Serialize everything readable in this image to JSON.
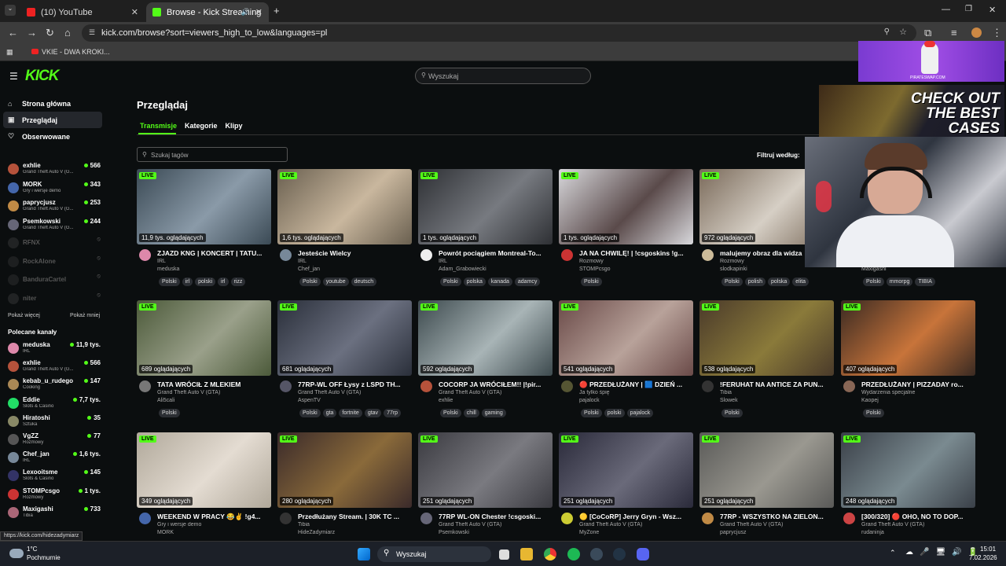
{
  "browser": {
    "tabs": [
      {
        "label": "(10) YouTube"
      },
      {
        "label": "Browse - Kick Streaming"
      }
    ],
    "url": "kick.com/browse?sort=viewers_high_to_low&languages=pl",
    "bookmark": "VKIE - DWA KROKI..."
  },
  "header": {
    "search_placeholder": "Wyszukaj"
  },
  "sidebar": {
    "nav": [
      {
        "label": "Strona główna"
      },
      {
        "label": "Przeglądaj"
      },
      {
        "label": "Obserwowane"
      }
    ],
    "followed": [
      {
        "name": "exhlie",
        "game": "Grand Theft Auto V (G...",
        "viewers": "566",
        "color": "#b5523b"
      },
      {
        "name": "MORK",
        "game": "Gry i wersje demo",
        "viewers": "343",
        "color": "#4466aa"
      },
      {
        "name": "paprycjusz",
        "game": "Grand Theft Auto V (G...",
        "viewers": "253",
        "color": "#c08a45"
      },
      {
        "name": "Psemkowski",
        "game": "Grand Theft Auto V (G...",
        "viewers": "244",
        "color": "#667"
      },
      {
        "name": "RFNX",
        "color": "#444"
      },
      {
        "name": "RockAlone",
        "color": "#3a3a3a"
      },
      {
        "name": "BanduraCartel",
        "color": "#3a3a3a"
      },
      {
        "name": "niter",
        "color": "#444"
      }
    ],
    "show_more": "Pokaż więcej",
    "show_less": "Pokaż mniej",
    "recommended_title": "Polecane kanały",
    "recommended": [
      {
        "name": "meduska",
        "game": "IRL",
        "viewers": "11,9 tys.",
        "color": "#d8a"
      },
      {
        "name": "exhlie",
        "game": "Grand Theft Auto V (G...",
        "viewers": "566",
        "color": "#b5523b"
      },
      {
        "name": "kebab_u_rudego",
        "game": "Cooking",
        "viewers": "147",
        "color": "#a85"
      },
      {
        "name": "Eddie",
        "game": "Slots & Casino",
        "viewers": "7,7 tys.",
        "color": "#2d6"
      },
      {
        "name": "Hiratoshi",
        "game": "Sztuka",
        "viewers": "35",
        "color": "#886"
      },
      {
        "name": "VgZZ",
        "game": "Rozmowy",
        "viewers": "77",
        "color": "#555"
      },
      {
        "name": "Chef_jan",
        "game": "IRL",
        "viewers": "1,6 tys.",
        "color": "#789"
      },
      {
        "name": "Lexooitsme",
        "game": "Slots & Casino",
        "viewers": "145",
        "color": "#336"
      },
      {
        "name": "STOMPcsgo",
        "game": "Rozmowy",
        "viewers": "1 tys.",
        "color": "#c33"
      },
      {
        "name": "Maxigashi",
        "game": "Tibia",
        "viewers": "733",
        "color": "#a67"
      }
    ],
    "status_url": "https://kick.com/hidezadymiarz"
  },
  "main": {
    "title": "Przeglądaj",
    "tabs": [
      {
        "label": "Transmisje"
      },
      {
        "label": "Kategorie"
      },
      {
        "label": "Klipy"
      }
    ],
    "tag_search_placeholder": "Szukaj tagów",
    "filter_label": "Filtruj według:",
    "live_label": "LIVE",
    "cards": [
      {
        "title": "ZJAZD KNG | KONCERT | TATU...",
        "cat": "IRL",
        "user": "meduska",
        "views": "11,9 tys. oglądających",
        "tags": [
          "Polski",
          "irl",
          "polski",
          "irl",
          "rizz"
        ],
        "c1": "#3b4a55",
        "c2": "#8a9aa8",
        "av": "#d8a"
      },
      {
        "title": "Jesteście Wielcy",
        "cat": "IRL",
        "user": "Chef_jan",
        "views": "1,6 tys. oglądających",
        "tags": [
          "Polski",
          "youtube",
          "deutsch"
        ],
        "c1": "#6a6050",
        "c2": "#c9b79e",
        "av": "#789"
      },
      {
        "title": "Powrót pociągiem Montreal-To...",
        "cat": "IRL",
        "user": "Adam_Grabowiecki",
        "views": "1 tys. oglądających",
        "tags": [
          "Polski",
          "polska",
          "kanada",
          "adamcy"
        ],
        "c1": "#2e3034",
        "c2": "#777a80",
        "av": "#eee"
      },
      {
        "title": "JA NA CHWILĘ! | !csgoskins !g...",
        "cat": "Rozmowy",
        "user": "STOMPcsgo",
        "views": "1 tys. oglądających",
        "tags": [
          "Polski"
        ],
        "c1": "#d8d8dc",
        "c2": "#5a4a4a",
        "av": "#c33"
      },
      {
        "title": "malujemy obraz dla widza",
        "cat": "Rozmowy",
        "user": "slodkapinki",
        "views": "972 oglądających",
        "tags": [
          "Polski",
          "polish",
          "polska",
          "elita"
        ],
        "c1": "#7a6a5a",
        "c2": "#d6cfc5",
        "av": "#cb9"
      },
      {
        "title": "",
        "cat": "",
        "user": "Maxigashi",
        "views": "",
        "tags": [
          "Polski",
          "mmorpg",
          "TIBIA"
        ],
        "c1": "#222",
        "c2": "#333",
        "av": "#a67"
      },
      {
        "title": "TATA WRÓCIŁ Z MLEKIEM",
        "cat": "Grand Theft Auto V (GTA)",
        "user": "Ali5cali",
        "views": "689 oglądających",
        "tags": [
          "Polski"
        ],
        "c1": "#4c5a3a",
        "c2": "#9aa08a",
        "av": "#777"
      },
      {
        "title": "77RP-WL OFF Łysy z LSPD TH...",
        "cat": "Grand Theft Auto V (GTA)",
        "user": "AspenTV",
        "views": "681 oglądających",
        "tags": [
          "Polski",
          "gta",
          "fortnite",
          "gtav",
          "77rp"
        ],
        "c1": "#2a2f3a",
        "c2": "#6b7080",
        "av": "#556"
      },
      {
        "title": "COCORP JA WRÓCIŁEM!! |!pir...",
        "cat": "Grand Theft Auto V (GTA)",
        "user": "exhlie",
        "views": "592 oglądających",
        "tags": [
          "Polski",
          "chill",
          "gaming"
        ],
        "c1": "#3d4a4e",
        "c2": "#a8b4b6",
        "av": "#b5523b"
      },
      {
        "title": "🔴 PRZEDŁUŻANY | 🟦 DZIEŃ ...",
        "cat": "Ja tylko śpię",
        "user": "pajalock",
        "views": "541 oglądających",
        "tags": [
          "Polski",
          "polski",
          "pajalock"
        ],
        "c1": "#6a4a48",
        "c2": "#b8a29a",
        "av": "#553"
      },
      {
        "title": "!FERUHAT NA ANTICE ZA PUN...",
        "cat": "Tibia",
        "user": "Slowek",
        "views": "538 oglądających",
        "tags": [
          "Polski"
        ],
        "c1": "#4a3a2a",
        "c2": "#8a7a3a",
        "av": "#333"
      },
      {
        "title": "PRZEDŁUŻANY | PIZZADAY ro...",
        "cat": "Wydarzenia specjalne",
        "user": "Kaopej",
        "views": "407 oglądających",
        "tags": [
          "Polski"
        ],
        "c1": "#3a2a22",
        "c2": "#c8743a",
        "av": "#865"
      },
      {
        "title": "WEEKEND W PRACY 😂✌ !g4...",
        "cat": "Gry i wersje demo",
        "user": "MORK",
        "views": "349 oglądających",
        "tags": [],
        "c1": "#b0a89a",
        "c2": "#e4dcd2",
        "av": "#4466aa"
      },
      {
        "title": "Przedłużany Stream. | 30K TC ...",
        "cat": "Tibia",
        "user": "HideZadymiarz",
        "views": "280 oglądających",
        "tags": [],
        "c1": "#3a2a2a",
        "c2": "#8a6a3a",
        "av": "#333"
      },
      {
        "title": "77RP WL-ON Chester !csgoski...",
        "cat": "Grand Theft Auto V (GTA)",
        "user": "Psemkowski",
        "views": "251 oglądających",
        "tags": [],
        "c1": "#3a3a40",
        "c2": "#7a7a80",
        "av": "#667"
      },
      {
        "title": "🟡 [CoCoRP] Jerry Gryn - Wsz...",
        "cat": "Grand Theft Auto V (GTA)",
        "user": "MyZone",
        "views": "251 oglądających",
        "tags": [],
        "c1": "#2a2a3a",
        "c2": "#6a6a7a",
        "av": "#cc3"
      },
      {
        "title": "77RP - WSZYSTKO NA ZIELON...",
        "cat": "Grand Theft Auto V (GTA)",
        "user": "paprycjusz",
        "views": "251 oglądających",
        "tags": [],
        "c1": "#5a5a58",
        "c2": "#9a9890",
        "av": "#c08a45"
      },
      {
        "title": "[300/320] 🔴 OHO, NO TO DOP...",
        "cat": "Grand Theft Auto V (GTA)",
        "user": "rudaninja",
        "views": "248 oglądających",
        "tags": [],
        "c1": "#3a4048",
        "c2": "#7a8a90",
        "av": "#c44"
      }
    ]
  },
  "overlay": {
    "ad1": "PIRATESWAP.COM",
    "ad2": "CHECK OUT THE BEST CASES"
  },
  "taskbar": {
    "weather_temp": "1°C",
    "weather_desc": "Pochmurnie",
    "search": "Wyszukaj",
    "time": "15:01",
    "date": "7.02.2026"
  }
}
